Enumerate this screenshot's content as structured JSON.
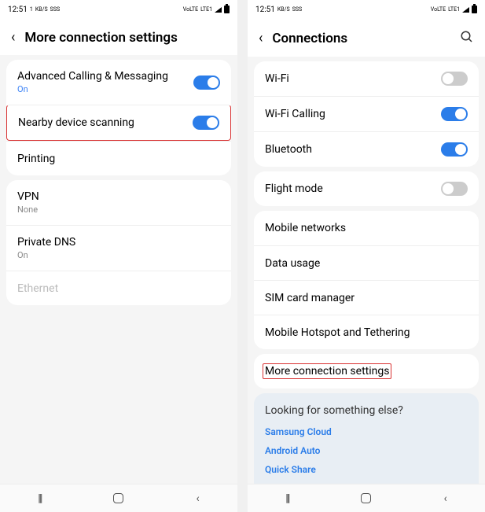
{
  "status": {
    "time": "12:51",
    "sim": "1",
    "net": "KB/S",
    "sss": "SSS",
    "volte": "VoLTE",
    "lte": "LTE1"
  },
  "left_screen": {
    "title": "More connection settings",
    "card1": [
      {
        "label": "Advanced Calling & Messaging",
        "sub": "On",
        "sub_style": "blue",
        "toggle": "on"
      },
      {
        "label": "Nearby device scanning",
        "toggle": "on",
        "highlight": true
      },
      {
        "label": "Printing"
      }
    ],
    "card2": [
      {
        "label": "VPN",
        "sub": "None",
        "sub_style": "grey"
      },
      {
        "label": "Private DNS",
        "sub": "On",
        "sub_style": "grey"
      },
      {
        "label": "Ethernet",
        "disabled": true
      }
    ]
  },
  "right_screen": {
    "title": "Connections",
    "card1": [
      {
        "label": "Wi-Fi",
        "toggle": "off"
      },
      {
        "label": "Wi-Fi Calling",
        "toggle": "on"
      },
      {
        "label": "Bluetooth",
        "toggle": "on"
      }
    ],
    "card2": [
      {
        "label": "Flight mode",
        "toggle": "off"
      }
    ],
    "card3": [
      {
        "label": "Mobile networks"
      },
      {
        "label": "Data usage"
      },
      {
        "label": "SIM card manager"
      },
      {
        "label": "Mobile Hotspot and Tethering"
      }
    ],
    "card4": [
      {
        "label": "More connection settings",
        "highlight": true
      }
    ],
    "footer": {
      "title": "Looking for something else?",
      "links": [
        "Samsung Cloud",
        "Android Auto",
        "Quick Share"
      ]
    }
  }
}
